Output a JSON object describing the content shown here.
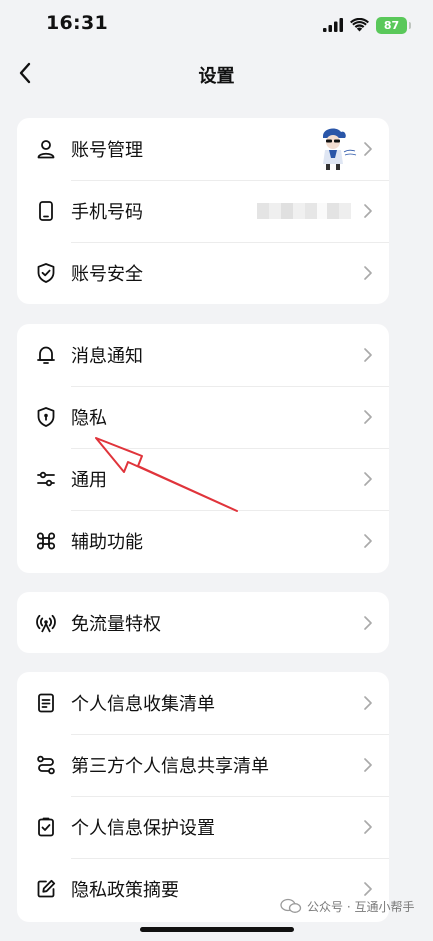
{
  "status_bar": {
    "time": "16:31",
    "battery": "87"
  },
  "nav": {
    "title": "设置"
  },
  "groups": [
    {
      "items": [
        {
          "label": "账号管理",
          "icon": "person-icon"
        },
        {
          "label": "手机号码",
          "icon": "phone-icon",
          "value": "(blurred)"
        },
        {
          "label": "账号安全",
          "icon": "shield-check-icon"
        }
      ]
    },
    {
      "items": [
        {
          "label": "消息通知",
          "icon": "bell-icon"
        },
        {
          "label": "隐私",
          "icon": "privacy-shield-icon"
        },
        {
          "label": "通用",
          "icon": "sliders-icon"
        },
        {
          "label": "辅助功能",
          "icon": "command-icon"
        }
      ]
    },
    {
      "items": [
        {
          "label": "免流量特权",
          "icon": "signal-tower-icon"
        }
      ]
    },
    {
      "items": [
        {
          "label": "个人信息收集清单",
          "icon": "document-icon"
        },
        {
          "label": "第三方个人信息共享清单",
          "icon": "share-icon"
        },
        {
          "label": "个人信息保护设置",
          "icon": "clipboard-check-icon"
        },
        {
          "label": "隐私政策摘要",
          "icon": "edit-icon"
        }
      ]
    }
  ],
  "watermark": {
    "text": "公众号 · 互通小帮手"
  },
  "colors": {
    "background": "#f2f3f5",
    "card": "#ffffff",
    "annotation_arrow": "#e0343b",
    "battery": "#5ac85a"
  }
}
